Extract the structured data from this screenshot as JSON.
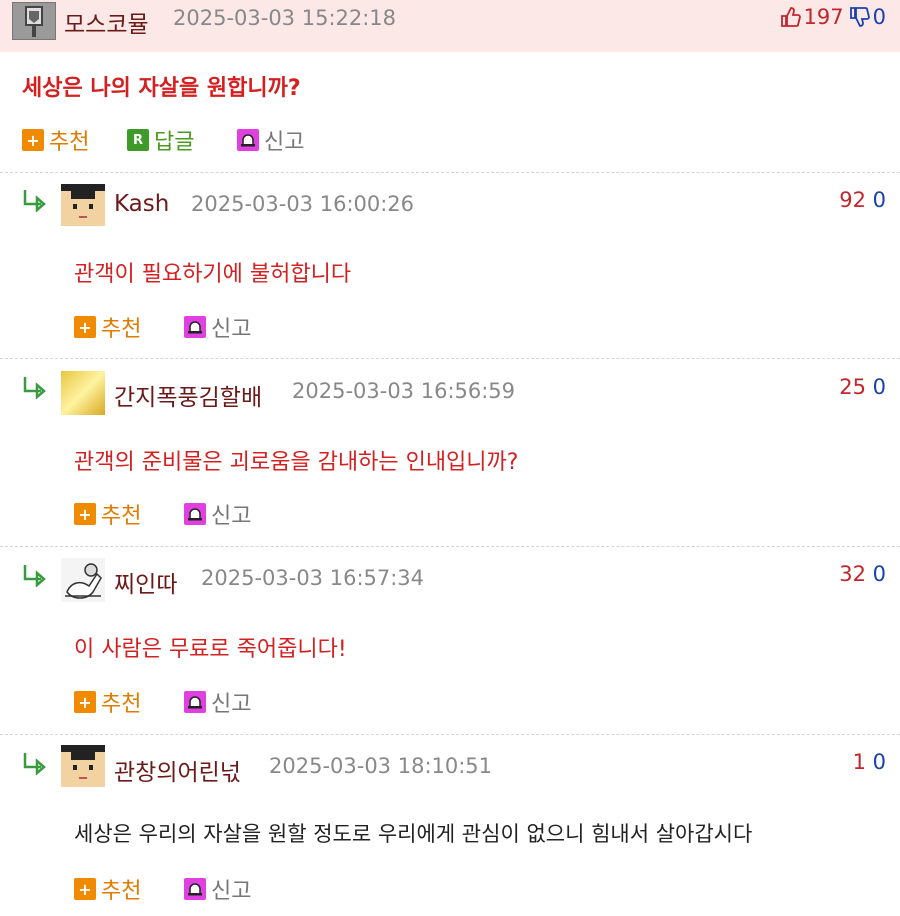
{
  "post": {
    "nick": "모스코뮬",
    "date": "2025-03-03 15:22:18",
    "up": "197",
    "down": "0",
    "title": "세상은 나의 자살을 원합니까?",
    "actions": {
      "recommend": "추천",
      "reply": "답글",
      "report": "신고"
    }
  },
  "comments": [
    {
      "nick": "Kash",
      "date": "2025-03-03 16:00:26",
      "up": "92",
      "down": "0",
      "text": "관객이 필요하기에 불허합니다",
      "recommend": "추천",
      "report": "신고"
    },
    {
      "nick": "간지폭풍김할배",
      "date": "2025-03-03 16:56:59",
      "up": "25",
      "down": "0",
      "text": "관객의 준비물은 괴로움을 감내하는 인내입니까?",
      "recommend": "추천",
      "report": "신고"
    },
    {
      "nick": "찌인따",
      "date": "2025-03-03 16:57:34",
      "up": "32",
      "down": "0",
      "text": "이 사람은 무료로 죽어줍니다!",
      "recommend": "추천",
      "report": "신고"
    },
    {
      "nick": "관창의어린넋",
      "date": "2025-03-03 18:10:51",
      "up": "1",
      "down": "0",
      "text": "세상은 우리의 자살을 원할 정도로 우리에게 관심이 없으니 힘내서 살아갑시다",
      "recommend": "추천",
      "report": "신고"
    }
  ],
  "colors": {
    "header_bg": "#fde8e8",
    "accent_red": "#d42020",
    "recommend_orange": "#e07b00",
    "reply_green": "#4a9a20"
  }
}
